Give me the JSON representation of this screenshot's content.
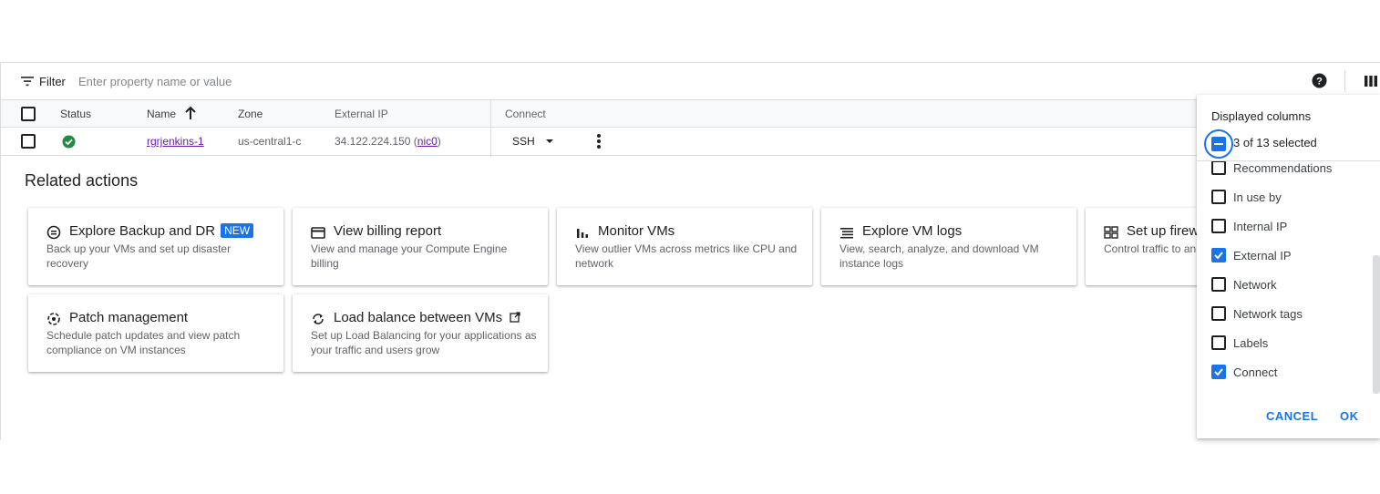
{
  "filter": {
    "label": "Filter",
    "placeholder": "Enter property name or value"
  },
  "table": {
    "headers": {
      "status": "Status",
      "name": "Name",
      "zone": "Zone",
      "external_ip": "External IP",
      "connect": "Connect"
    },
    "sort_indicator": "ascending",
    "rows": [
      {
        "status": "running",
        "name": "rgrjenkins-1",
        "zone": "us-central1-c",
        "external_ip": "34.122.224.150",
        "nic": "nic0",
        "connect": "SSH"
      }
    ]
  },
  "related": {
    "title": "Related actions",
    "cards": [
      {
        "icon": "backup-icon",
        "title": "Explore Backup and DR",
        "badge": "NEW",
        "desc": "Back up your VMs and set up disaster recovery"
      },
      {
        "icon": "billing-icon",
        "title": "View billing report",
        "desc": "View and manage your Compute Engine billing"
      },
      {
        "icon": "bar-chart-icon",
        "title": "Monitor VMs",
        "desc": "View outlier VMs across metrics like CPU and network"
      },
      {
        "icon": "logs-icon",
        "title": "Explore VM logs",
        "desc": "View, search, analyze, and download VM instance logs"
      },
      {
        "icon": "firewall-icon",
        "title": "Set up firew",
        "desc": "Control traffic to an"
      },
      {
        "icon": "patch-icon",
        "title": "Patch management",
        "desc": "Schedule patch updates and view patch compliance on VM instances"
      },
      {
        "icon": "load-balance-icon",
        "title": "Load balance between VMs",
        "desc": "Set up Load Balancing for your applications as your traffic and users grow"
      }
    ]
  },
  "columns_panel": {
    "title": "Displayed columns",
    "selected_text": "3 of 13 selected",
    "items": [
      {
        "label": "Recommendations",
        "checked": false
      },
      {
        "label": "In use by",
        "checked": false
      },
      {
        "label": "Internal IP",
        "checked": false
      },
      {
        "label": "External IP",
        "checked": true
      },
      {
        "label": "Network",
        "checked": false
      },
      {
        "label": "Network tags",
        "checked": false
      },
      {
        "label": "Labels",
        "checked": false
      },
      {
        "label": "Connect",
        "checked": true
      }
    ],
    "cancel_label": "CANCEL",
    "ok_label": "OK"
  },
  "colors": {
    "accent": "#1a73e8",
    "success": "#1e8e3e",
    "link_visited": "#681da8"
  }
}
